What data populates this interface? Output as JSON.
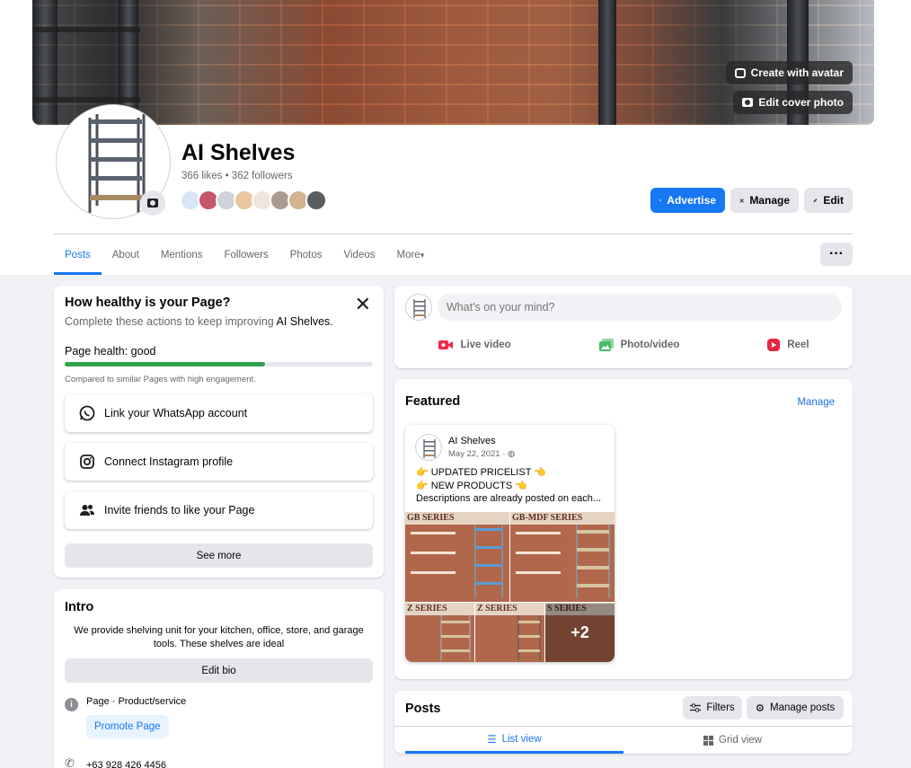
{
  "cover": {
    "create_avatar": "Create with avatar",
    "edit_cover": "Edit cover photo"
  },
  "page": {
    "name": "AI Shelves",
    "stats": "366 likes • 362 followers",
    "face_colors": [
      "#d7e6f6",
      "#c4566a",
      "#cfd2d6",
      "#e9c7a3",
      "#efe5dc",
      "#a89a8f",
      "#d4b48e",
      "#595d60"
    ]
  },
  "actions": {
    "advertise": "Advertise",
    "manage": "Manage",
    "edit": "Edit"
  },
  "tabs": [
    {
      "label": "Posts"
    },
    {
      "label": "About"
    },
    {
      "label": "Mentions"
    },
    {
      "label": "Followers"
    },
    {
      "label": "Photos"
    },
    {
      "label": "Videos"
    },
    {
      "label": "More"
    }
  ],
  "health": {
    "title": "How healthy is your Page?",
    "subtitle_prefix": "Complete these actions to keep improving ",
    "subtitle_page": "AI Shelves.",
    "status": "Page health: good",
    "progress": 0.65,
    "compare": "Compared to similar Pages with high engagement.",
    "tasks": [
      {
        "label": "Link your WhatsApp account",
        "icon": "whatsapp-icon"
      },
      {
        "label": "Connect Instagram profile",
        "icon": "instagram-icon"
      },
      {
        "label": "Invite friends to like your Page",
        "icon": "people-icon"
      }
    ],
    "see_more": "See more"
  },
  "intro": {
    "title": "Intro",
    "bio": "We provide shelving unit for your kitchen, office, store, and garage tools. These shelves are ideal",
    "edit_bio": "Edit bio",
    "category": "Page · Product/service",
    "promote": "Promote Page",
    "phone": "+63 928 426 4456"
  },
  "composer": {
    "placeholder": "What's on your mind?",
    "live": "Live video",
    "photo": "Photo/video",
    "reel": "Reel"
  },
  "featured": {
    "title": "Featured",
    "manage": "Manage",
    "post": {
      "author": "AI Shelves",
      "date": "May 22, 2021 ·",
      "line1": "UPDATED PRICELIST",
      "line2": "NEW PRODUCTS",
      "line3": "Descriptions are already posted on each...",
      "more_count": "+2",
      "img_labels": [
        "GB SERIES",
        "GB-MDF SERIES",
        "Z SERIES",
        "Z SERIES",
        "S SERIES"
      ]
    }
  },
  "posts": {
    "title": "Posts",
    "filters": "Filters",
    "manage_posts": "Manage posts",
    "list_view": "List view",
    "grid_view": "Grid view"
  }
}
